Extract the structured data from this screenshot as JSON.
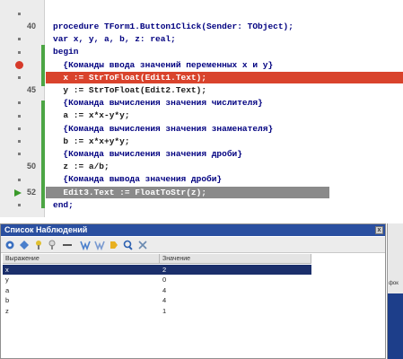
{
  "editor": {
    "gutter": [
      {
        "num": "",
        "mark": "dot"
      },
      {
        "num": "40",
        "mark": "none"
      },
      {
        "num": "",
        "mark": "dot"
      },
      {
        "num": "",
        "mark": "dot"
      },
      {
        "num": "",
        "mark": "breakpoint"
      },
      {
        "num": "",
        "mark": "dot"
      },
      {
        "num": "45",
        "mark": "none"
      },
      {
        "num": "",
        "mark": "dot"
      },
      {
        "num": "",
        "mark": "dot"
      },
      {
        "num": "",
        "mark": "dot"
      },
      {
        "num": "",
        "mark": "dot"
      },
      {
        "num": "",
        "mark": "dot"
      },
      {
        "num": "50",
        "mark": "none"
      },
      {
        "num": "",
        "mark": "dot"
      },
      {
        "num": "52",
        "mark": "exec"
      },
      {
        "num": "",
        "mark": "dot"
      }
    ],
    "lines": [
      {
        "text": "procedure TForm1.Button1Click(Sender: TObject);",
        "kind": "kw"
      },
      {
        "text": "var x, y, a, b, z: real;",
        "kind": "kw"
      },
      {
        "text": "begin",
        "kind": "kw"
      },
      {
        "text": "  {Команды ввода значений переменных x и y}",
        "kind": "comment"
      },
      {
        "text": "  x := StrToFloat(Edit1.Text);",
        "kind": "breakpoint"
      },
      {
        "text": "  y := StrToFloat(Edit2.Text);",
        "kind": "normal"
      },
      {
        "text": "  {Команда вычисления значения числителя}",
        "kind": "comment"
      },
      {
        "text": "  a := x*x-y*y;",
        "kind": "normal"
      },
      {
        "text": "  {Команда вычисления значения знаменателя}",
        "kind": "comment"
      },
      {
        "text": "  b := x*x+y*y;",
        "kind": "normal"
      },
      {
        "text": "  {Команда вычисления значения дроби}",
        "kind": "comment"
      },
      {
        "text": "  z := a/b;",
        "kind": "normal"
      },
      {
        "text": "  {Команда вывода значения дроби}",
        "kind": "comment"
      },
      {
        "text": "  Edit3.Text := FloatToStr(z);",
        "kind": "exec"
      },
      {
        "text": "end;",
        "kind": "kw"
      }
    ]
  },
  "watch": {
    "title": "Список Наблюдений",
    "close_label": "x",
    "columns": [
      "Выражение",
      "Значение"
    ],
    "rows": [
      {
        "expr": "x",
        "value": "2",
        "selected": true
      },
      {
        "expr": "y",
        "value": "0",
        "selected": false
      },
      {
        "expr": "a",
        "value": "4",
        "selected": false
      },
      {
        "expr": "b",
        "value": "4",
        "selected": false
      },
      {
        "expr": "z",
        "value": "1",
        "selected": false
      }
    ],
    "toolbar": [
      "settings-icon",
      "add-icon",
      "watch-icon",
      "remove-icon",
      "disable-icon",
      "enable-icon",
      "evaluate-icon",
      "inspect-icon",
      "delete-icon"
    ]
  },
  "right_strip": {
    "label": "фок"
  },
  "colors": {
    "breakpoint_line": "#d9432c",
    "exec_line": "#8a8a8a",
    "keyword": "#000080",
    "watch_title": "#2a4fa0",
    "selected_row": "#1b2f6b"
  }
}
